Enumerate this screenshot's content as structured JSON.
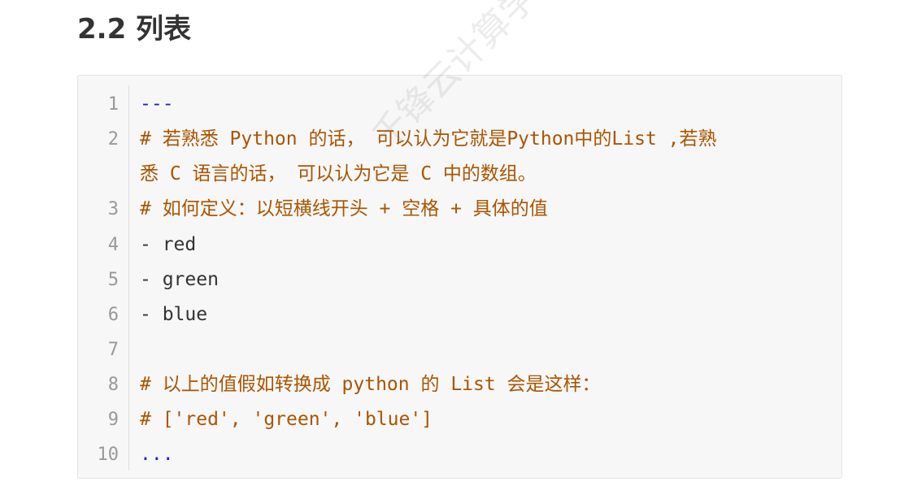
{
  "heading": "2.2 列表",
  "watermark": "千锋云计算学院",
  "code_lines": [
    {
      "number": "1",
      "text": "---"
    },
    {
      "number": "2",
      "text": "# 若熟悉 Python 的话， 可以认为它就是Python中的List ,若熟"
    },
    {
      "number": "",
      "text": "悉 C 语言的话， 可以认为它是 C 中的数组。"
    },
    {
      "number": "3",
      "text": "# 如何定义：以短横线开头 + 空格 + 具体的值"
    },
    {
      "number": "4",
      "text": "- red"
    },
    {
      "number": "5",
      "text": "- green"
    },
    {
      "number": "6",
      "text": "- blue"
    },
    {
      "number": "7",
      "text": ""
    },
    {
      "number": "8",
      "text": "# 以上的值假如转换成 python 的 List 会是这样："
    },
    {
      "number": "9",
      "text": "# ['red', 'green', 'blue']"
    },
    {
      "number": "10",
      "text": "..."
    }
  ],
  "colors": {
    "comment": "#aa5500",
    "text": "#333333",
    "marker": "#2222cc",
    "line_number": "#999999",
    "background": "#f7f7f7"
  }
}
